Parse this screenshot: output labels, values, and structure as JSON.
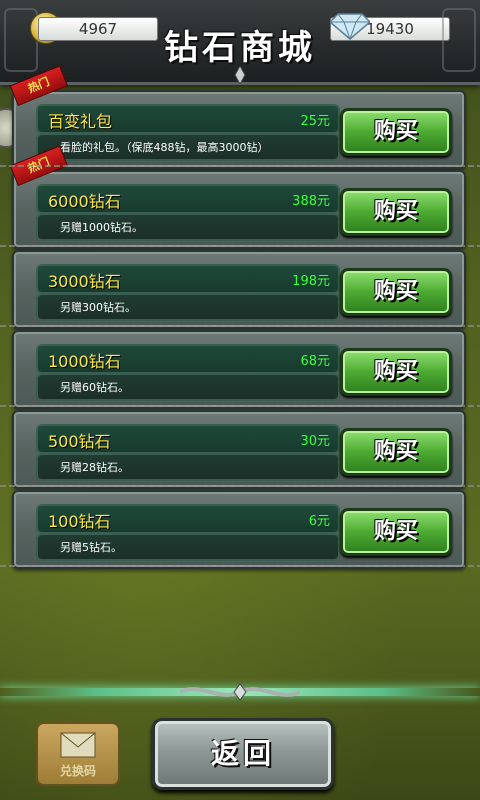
{
  "header": {
    "title": "钻石商城",
    "gold": "4967",
    "diamonds": "19430",
    "gold_icon": "coin-icon",
    "diamond_icon": "diamond-icon"
  },
  "hot_label": "热门",
  "buy_label": "购买",
  "items": [
    {
      "name": "百变礼包",
      "price": "25元",
      "desc": "看脸的礼包。（保底488钻，最高3000钻）",
      "hot": true
    },
    {
      "name": "6000钻石",
      "price": "388元",
      "desc": "另赠1000钻石。",
      "hot": true
    },
    {
      "name": "3000钻石",
      "price": "198元",
      "desc": "另赠300钻石。",
      "hot": false
    },
    {
      "name": "1000钻石",
      "price": "68元",
      "desc": "另赠60钻石。",
      "hot": false
    },
    {
      "name": "500钻石",
      "price": "30元",
      "desc": "另赠28钻石。",
      "hot": false
    },
    {
      "name": "100钻石",
      "price": "6元",
      "desc": "另赠5钻石。",
      "hot": false
    }
  ],
  "footer": {
    "redeem_label": "兑换码",
    "back_label": "返回"
  },
  "colors": {
    "price": "#3cff3c",
    "name": "#ffe84a",
    "buy_button": "#4caa32"
  }
}
